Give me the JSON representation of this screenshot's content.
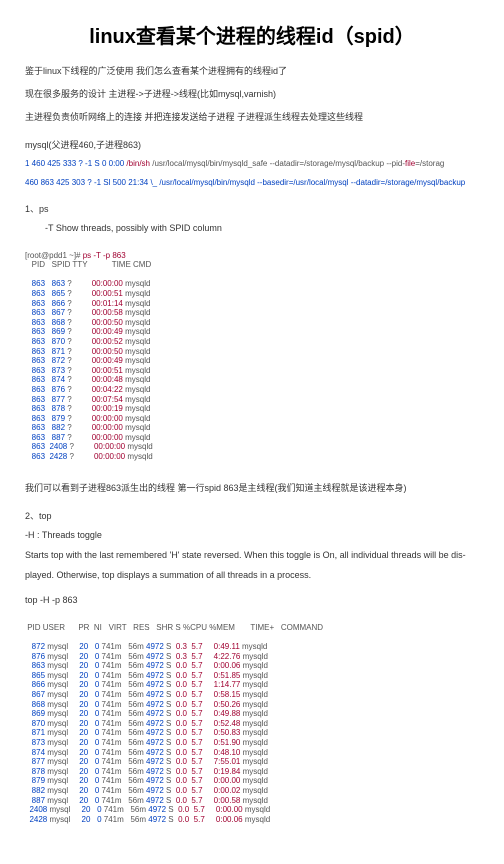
{
  "title": "linux查看某个进程的线程id（spid）",
  "para1": "鉴于linux下线程的广泛使用 我们怎么查看某个进程拥有的线程id了",
  "para2": "现在很多服务的设计 主进程->子进程->线程(比如mysql,varnish)",
  "para3": "主进程负责侦听网络上的连接 并把连接发送给子进程 子进程派生线程去处理这些线程",
  "section1": "mysql(父进程460,子进程863)",
  "cmdline1_part1": "   1   460   425   333 ?               -1 S         0   0:00 ",
  "cmdline1_bin": "/bin/sh",
  "cmdline1_rest": " /usr/local/mysql/bin/mysqld_safe --datadir=/storage/mysql/backup --pid-",
  "cmdline1_file": "file",
  "cmdline1_end": "=/storag",
  "cmdline2_part1": " 460   863   425   303 ?               -1 Sl     500 21:34  \\_ /usr/local/mysql/bin/mysqld --basedir=/usr/local/mysql --datadir=/storage/mysql/backup",
  "section2": "1、ps",
  "indent1": "-T Show threads, possibly with SPID column",
  "ps_cmd": "[root@pdd1 ~]# ",
  "ps_cmd2": "ps -T -p 863",
  "ps_header": "   PID   SPID TTY           TIME CMD",
  "ps_rows": [
    {
      "pid": "   863",
      "spid": "   863",
      "tty": "?",
      "time": "00:00:00",
      "cmd": "mysqld"
    },
    {
      "pid": "   863",
      "spid": "   865",
      "tty": "?",
      "time": "00:00:51",
      "cmd": "mysqld"
    },
    {
      "pid": "   863",
      "spid": "   866",
      "tty": "?",
      "time": "00:01:14",
      "cmd": "mysqld"
    },
    {
      "pid": "   863",
      "spid": "   867",
      "tty": "?",
      "time": "00:00:58",
      "cmd": "mysqld"
    },
    {
      "pid": "   863",
      "spid": "   868",
      "tty": "?",
      "time": "00:00:50",
      "cmd": "mysqld"
    },
    {
      "pid": "   863",
      "spid": "   869",
      "tty": "?",
      "time": "00:00:49",
      "cmd": "mysqld"
    },
    {
      "pid": "   863",
      "spid": "   870",
      "tty": "?",
      "time": "00:00:52",
      "cmd": "mysqld"
    },
    {
      "pid": "   863",
      "spid": "   871",
      "tty": "?",
      "time": "00:00:50",
      "cmd": "mysqld"
    },
    {
      "pid": "   863",
      "spid": "   872",
      "tty": "?",
      "time": "00:00:49",
      "cmd": "mysqld"
    },
    {
      "pid": "   863",
      "spid": "   873",
      "tty": "?",
      "time": "00:00:51",
      "cmd": "mysqld"
    },
    {
      "pid": "   863",
      "spid": "   874",
      "tty": "?",
      "time": "00:00:48",
      "cmd": "mysqld"
    },
    {
      "pid": "   863",
      "spid": "   876",
      "tty": "?",
      "time": "00:04:22",
      "cmd": "mysqld"
    },
    {
      "pid": "   863",
      "spid": "   877",
      "tty": "?",
      "time": "00:07:54",
      "cmd": "mysqld"
    },
    {
      "pid": "   863",
      "spid": "   878",
      "tty": "?",
      "time": "00:00:19",
      "cmd": "mysqld"
    },
    {
      "pid": "   863",
      "spid": "   879",
      "tty": "?",
      "time": "00:00:00",
      "cmd": "mysqld"
    },
    {
      "pid": "   863",
      "spid": "   882",
      "tty": "?",
      "time": "00:00:00",
      "cmd": "mysqld"
    },
    {
      "pid": "   863",
      "spid": "   887",
      "tty": "?",
      "time": "00:00:00",
      "cmd": "mysqld"
    },
    {
      "pid": "   863",
      "spid": "  2408",
      "tty": "?",
      "time": "00:00:00",
      "cmd": "mysqld"
    },
    {
      "pid": "   863",
      "spid": "  2428",
      "tty": "?",
      "time": "00:00:00",
      "cmd": "mysqld"
    }
  ],
  "para4": "我们可以看到子进程863派生出的线程  第一行spid 863是主线程(我们知道主线程就是该进程本身)",
  "section3": "2、top",
  "top_h": "-H : Threads toggle",
  "top_desc1": "Starts top with the last remembered 'H' state reversed. When this toggle is On, all individual threads will be dis-",
  "top_desc2": "played. Otherwise, top displays a summation of all threads in a process.",
  "top_cmd": "top -H -p 863",
  "top_header": " PID USER      PR  NI   VIRT   RES   SHR S %CPU %MEM       TIME+   COMMAND",
  "top_rows": [
    {
      "pid": "   872",
      "user": "mysql",
      "pr": "20",
      "ni": "0",
      "virt": "741m",
      "res": "56m",
      "shr": "4972",
      "s": "S",
      "cpu": "0.3",
      "mem": "5.7",
      "time": "0:49.11",
      "cmd": "mysqld"
    },
    {
      "pid": "   876",
      "user": "mysql",
      "pr": "20",
      "ni": "0",
      "virt": "741m",
      "res": "56m",
      "shr": "4972",
      "s": "S",
      "cpu": "0.3",
      "mem": "5.7",
      "time": "4:22.76",
      "cmd": "mysqld"
    },
    {
      "pid": "   863",
      "user": "mysql",
      "pr": "20",
      "ni": "0",
      "virt": "741m",
      "res": "56m",
      "shr": "4972",
      "s": "S",
      "cpu": "0.0",
      "mem": "5.7",
      "time": "0:00.06",
      "cmd": "mysqld"
    },
    {
      "pid": "   865",
      "user": "mysql",
      "pr": "20",
      "ni": "0",
      "virt": "741m",
      "res": "56m",
      "shr": "4972",
      "s": "S",
      "cpu": "0.0",
      "mem": "5.7",
      "time": "0:51.85",
      "cmd": "mysqld"
    },
    {
      "pid": "   866",
      "user": "mysql",
      "pr": "20",
      "ni": "0",
      "virt": "741m",
      "res": "56m",
      "shr": "4972",
      "s": "S",
      "cpu": "0.0",
      "mem": "5.7",
      "time": "1:14.77",
      "cmd": "mysqld"
    },
    {
      "pid": "   867",
      "user": "mysql",
      "pr": "20",
      "ni": "0",
      "virt": "741m",
      "res": "56m",
      "shr": "4972",
      "s": "S",
      "cpu": "0.0",
      "mem": "5.7",
      "time": "0:58.15",
      "cmd": "mysqld"
    },
    {
      "pid": "   868",
      "user": "mysql",
      "pr": "20",
      "ni": "0",
      "virt": "741m",
      "res": "56m",
      "shr": "4972",
      "s": "S",
      "cpu": "0.0",
      "mem": "5.7",
      "time": "0:50.26",
      "cmd": "mysqld"
    },
    {
      "pid": "   869",
      "user": "mysql",
      "pr": "20",
      "ni": "0",
      "virt": "741m",
      "res": "56m",
      "shr": "4972",
      "s": "S",
      "cpu": "0.0",
      "mem": "5.7",
      "time": "0:49.88",
      "cmd": "mysqld"
    },
    {
      "pid": "   870",
      "user": "mysql",
      "pr": "20",
      "ni": "0",
      "virt": "741m",
      "res": "56m",
      "shr": "4972",
      "s": "S",
      "cpu": "0.0",
      "mem": "5.7",
      "time": "0:52.48",
      "cmd": "mysqld"
    },
    {
      "pid": "   871",
      "user": "mysql",
      "pr": "20",
      "ni": "0",
      "virt": "741m",
      "res": "56m",
      "shr": "4972",
      "s": "S",
      "cpu": "0.0",
      "mem": "5.7",
      "time": "0:50.83",
      "cmd": "mysqld"
    },
    {
      "pid": "   873",
      "user": "mysql",
      "pr": "20",
      "ni": "0",
      "virt": "741m",
      "res": "56m",
      "shr": "4972",
      "s": "S",
      "cpu": "0.0",
      "mem": "5.7",
      "time": "0:51.90",
      "cmd": "mysqld"
    },
    {
      "pid": "   874",
      "user": "mysql",
      "pr": "20",
      "ni": "0",
      "virt": "741m",
      "res": "56m",
      "shr": "4972",
      "s": "S",
      "cpu": "0.0",
      "mem": "5.7",
      "time": "0:48.10",
      "cmd": "mysqld"
    },
    {
      "pid": "   877",
      "user": "mysql",
      "pr": "20",
      "ni": "0",
      "virt": "741m",
      "res": "56m",
      "shr": "4972",
      "s": "S",
      "cpu": "0.0",
      "mem": "5.7",
      "time": "7:55.01",
      "cmd": "mysqld"
    },
    {
      "pid": "   878",
      "user": "mysql",
      "pr": "20",
      "ni": "0",
      "virt": "741m",
      "res": "56m",
      "shr": "4972",
      "s": "S",
      "cpu": "0.0",
      "mem": "5.7",
      "time": "0:19.84",
      "cmd": "mysqld"
    },
    {
      "pid": "   879",
      "user": "mysql",
      "pr": "20",
      "ni": "0",
      "virt": "741m",
      "res": "56m",
      "shr": "4972",
      "s": "S",
      "cpu": "0.0",
      "mem": "5.7",
      "time": "0:00.00",
      "cmd": "mysqld"
    },
    {
      "pid": "   882",
      "user": "mysql",
      "pr": "20",
      "ni": "0",
      "virt": "741m",
      "res": "56m",
      "shr": "4972",
      "s": "S",
      "cpu": "0.0",
      "mem": "5.7",
      "time": "0:00.02",
      "cmd": "mysqld"
    },
    {
      "pid": "   887",
      "user": "mysql",
      "pr": "20",
      "ni": "0",
      "virt": "741m",
      "res": "56m",
      "shr": "4972",
      "s": "S",
      "cpu": "0.0",
      "mem": "5.7",
      "time": "0:00.58",
      "cmd": "mysqld"
    },
    {
      "pid": "  2408",
      "user": "mysql",
      "pr": "20",
      "ni": "0",
      "virt": "741m",
      "res": "56m",
      "shr": "4972",
      "s": "S",
      "cpu": "0.0",
      "mem": "5.7",
      "time": "0:00.00",
      "cmd": "mysqld"
    },
    {
      "pid": "  2428",
      "user": "mysql",
      "pr": "20",
      "ni": "0",
      "virt": "741m",
      "res": "56m",
      "shr": "4972",
      "s": "S",
      "cpu": "0.0",
      "mem": "5.7",
      "time": "0:00.06",
      "cmd": "mysqld"
    }
  ]
}
